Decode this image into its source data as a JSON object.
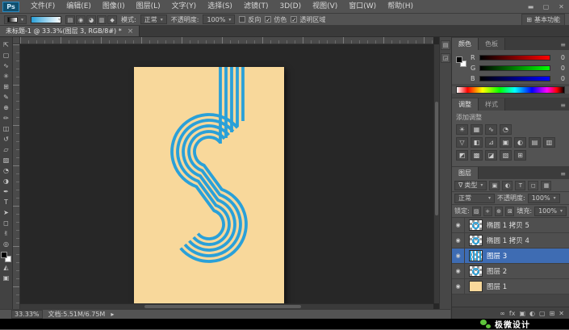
{
  "app": {
    "logo": "Ps",
    "window_controls": [
      "▬",
      "▢",
      "✕"
    ]
  },
  "colors": {
    "artwork_blue": "#2AA0D8",
    "artboard_cream": "#F8D89B",
    "selected_layer_blue": "#3E6CB3",
    "panel_gray": "#535353",
    "canvas_gray": "#272727"
  },
  "ui": {
    "caret": "▾",
    "panel_menu_glyph": "≡",
    "workspace_glyph": "⊞",
    "filter_glyph": "∇",
    "eye_glyph": "◉",
    "gradient_type_glyphs": [
      "▤",
      "◉",
      "◕",
      "▥",
      "◆"
    ]
  },
  "menu_bar": {
    "items": [
      "文件(F)",
      "编辑(E)",
      "图像(I)",
      "图层(L)",
      "文字(Y)",
      "选择(S)",
      "滤镜(T)",
      "3D(D)",
      "视图(V)",
      "窗口(W)",
      "帮助(H)"
    ]
  },
  "options_bar": {
    "mode_label": "模式:",
    "mode_value": "正常",
    "opacity_label": "不透明度:",
    "opacity_value": "100%",
    "checkboxes": [
      {
        "label": "反向",
        "checked": false,
        "glyph": ""
      },
      {
        "label": "仿色",
        "checked": true,
        "glyph": "✓"
      },
      {
        "label": "透明区域",
        "checked": true,
        "glyph": "✓"
      }
    ],
    "workspace": "基本功能"
  },
  "document_tab": {
    "title": "未标题-1 @ 33.3%(图层 3, RGB/8#) *",
    "close_glyph": "×"
  },
  "toolbar": {
    "tools": [
      {
        "name": "move-tool",
        "glyph": "⇱"
      },
      {
        "name": "marquee-tool",
        "glyph": "▢"
      },
      {
        "name": "lasso-tool",
        "glyph": "∿"
      },
      {
        "name": "quick-selection-tool",
        "glyph": "✳"
      },
      {
        "name": "crop-tool",
        "glyph": "⊞"
      },
      {
        "name": "eyedropper-tool",
        "glyph": "✎"
      },
      {
        "name": "spot-healing-tool",
        "glyph": "⊕"
      },
      {
        "name": "brush-tool",
        "glyph": "✏"
      },
      {
        "name": "clone-stamp-tool",
        "glyph": "◫"
      },
      {
        "name": "history-brush-tool",
        "glyph": "↺"
      },
      {
        "name": "eraser-tool",
        "glyph": "▱"
      },
      {
        "name": "gradient-tool",
        "glyph": "▨"
      },
      {
        "name": "blur-tool",
        "glyph": "◔"
      },
      {
        "name": "dodge-tool",
        "glyph": "◑"
      },
      {
        "name": "pen-tool",
        "glyph": "✒"
      },
      {
        "name": "type-tool",
        "glyph": "T"
      },
      {
        "name": "path-selection-tool",
        "glyph": "➤"
      },
      {
        "name": "shape-tool",
        "glyph": "◻"
      },
      {
        "name": "hand-tool",
        "glyph": "✌"
      },
      {
        "name": "zoom-tool",
        "glyph": "◎"
      }
    ],
    "extras": [
      {
        "name": "quick-mask-button",
        "glyph": "◭"
      },
      {
        "name": "screen-mode-button",
        "glyph": "▣"
      }
    ]
  },
  "mini_dock": {
    "icons": [
      "▤",
      "◲"
    ]
  },
  "panels": {
    "color": {
      "tabs": [
        "颜色",
        "色板"
      ],
      "sliders": [
        {
          "label": "R",
          "value": "0"
        },
        {
          "label": "G",
          "value": "0"
        },
        {
          "label": "B",
          "value": "0"
        }
      ]
    },
    "adjustments": {
      "tabs": [
        "调整",
        "样式"
      ],
      "add_label": "添加调整",
      "rows": [
        [
          "☀",
          "▦",
          "∿",
          "◔"
        ],
        [
          "▽",
          "◧",
          "⊿",
          "▣",
          "◐",
          "▤",
          "▥"
        ],
        [
          "◩",
          "▩",
          "◪",
          "▧",
          "⊞"
        ]
      ]
    },
    "layers": {
      "tab": "图层",
      "filter_label": "类型",
      "filter_icons": [
        "▣",
        "◐",
        "T",
        "◻",
        "▦"
      ],
      "blend_mode": "正常",
      "opacity_label": "不透明度:",
      "opacity_value": "100%",
      "lock_label": "锁定:",
      "lock_icons": [
        "▨",
        "+",
        "⊕",
        "⊠"
      ],
      "fill_label": "填充:",
      "fill_value": "100%",
      "rows": [
        {
          "name": "椭圆 1 拷贝 5",
          "selected": false
        },
        {
          "name": "椭圆 1 拷贝 4",
          "selected": false
        },
        {
          "name": "图层 3",
          "selected": true
        },
        {
          "name": "图层 2",
          "selected": false
        },
        {
          "name": "图层 1",
          "selected": false
        }
      ],
      "bottom_icons": [
        "∞",
        "fx",
        "▣",
        "◐",
        "▢",
        "⊞",
        "✕"
      ]
    }
  },
  "status_bar": {
    "zoom": "33.33%",
    "doc_label": "文档:5.51M/6.75M",
    "expander": "▸"
  },
  "watermark": {
    "text": "极微设计"
  }
}
